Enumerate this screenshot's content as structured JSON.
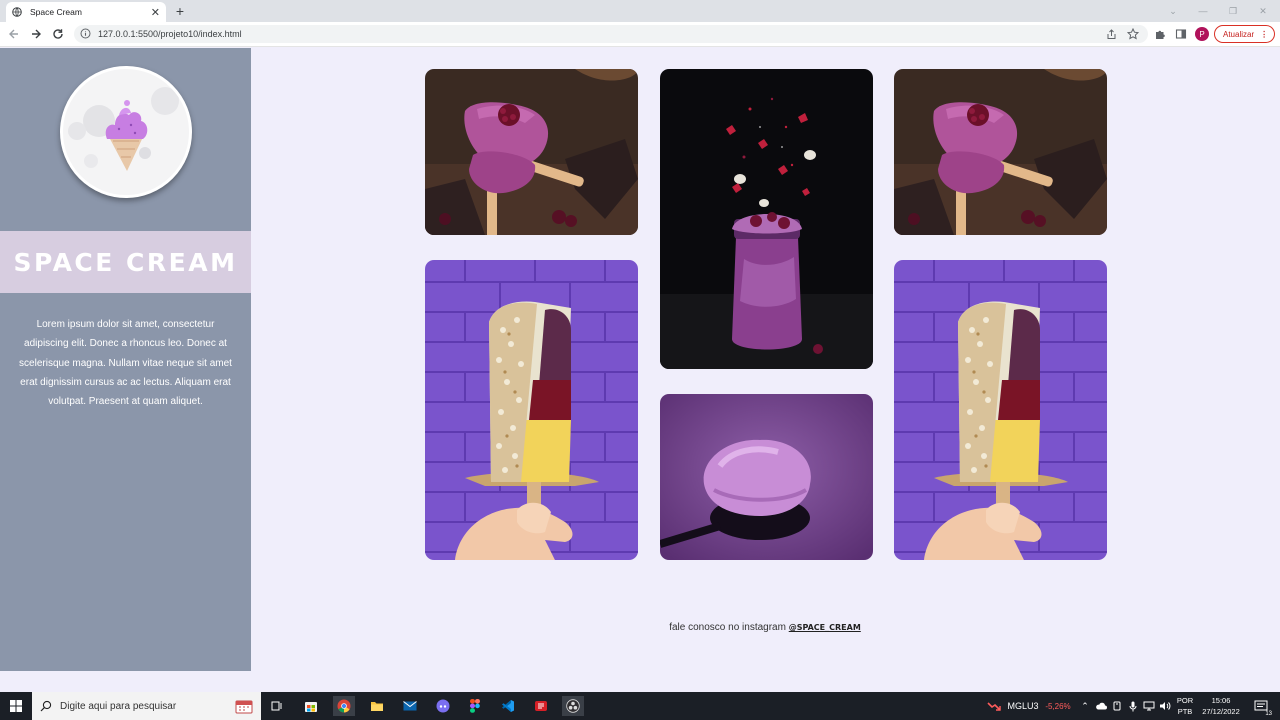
{
  "browser": {
    "tab_title": "Space Cream",
    "url": "127.0.0.1:5500/projeto10/index.html",
    "profile_initial": "P",
    "update_label": "Atualizar"
  },
  "sidebar": {
    "brand": "SPACE CREAM",
    "description": "Lorem ipsum dolor sit amet, consectetur adipiscing elit. Donec a rhoncus leo. Donec at scelerisque magna. Nullam vitae neque sit amet erat dignissim cursus ac ac lectus. Aliquam erat volutpat. Praesent at quam aliquet."
  },
  "gallery": {
    "photos": [
      {
        "subject": "berry-popsicle"
      },
      {
        "subject": "berry-milkshake-jar"
      },
      {
        "subject": "berry-popsicle"
      },
      {
        "subject": "nut-coated-popsicle"
      },
      {
        "subject": "scoop-on-spoon"
      },
      {
        "subject": "nut-coated-popsicle"
      }
    ]
  },
  "footer": {
    "text": "fale conosco no instagram ",
    "instagram": "@SPACE_CREAM"
  },
  "taskbar": {
    "search_placeholder": "Digite aqui para pesquisar",
    "stock_name": "MGLU3",
    "stock_change": "-5,26%",
    "lang_line1": "POR",
    "lang_line2": "PTB",
    "time": "15:06",
    "date": "27/12/2022",
    "notification_count": "13"
  },
  "colors": {
    "page_bg": "#f0eefb",
    "sidebar_bg": "#8b96aa",
    "brand_band": "#d7cde0",
    "taskbar_bg": "#1b1f26"
  }
}
